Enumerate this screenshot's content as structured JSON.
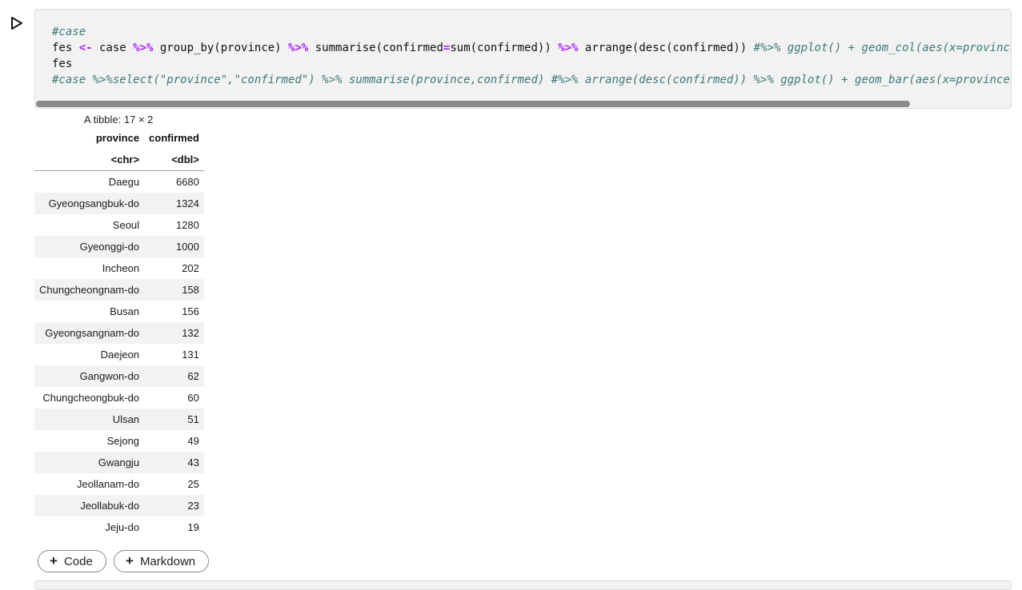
{
  "cell": {
    "code_lines": [
      [
        {
          "t": "#case",
          "c": "cm"
        }
      ],
      [
        {
          "t": "fes "
        },
        {
          "t": "<-",
          "c": "kw"
        },
        {
          "t": " case "
        },
        {
          "t": "%>%",
          "c": "kw"
        },
        {
          "t": " group_by(province) "
        },
        {
          "t": "%>%",
          "c": "kw"
        },
        {
          "t": " summarise(confirmed"
        },
        {
          "t": "=",
          "c": "kw"
        },
        {
          "t": "sum(confirmed)) "
        },
        {
          "t": "%>%",
          "c": "kw"
        },
        {
          "t": " arrange(desc(confirmed)) "
        },
        {
          "t": "#%>% ggplot() + geom_col(aes(x=province",
          "c": "cm"
        }
      ],
      [
        {
          "t": "fes"
        }
      ],
      [
        {
          "t": "#case %>%select(\"province\",\"confirmed\") %>% summarise(province,confirmed) #%>% arrange(desc(confirmed)) %>% ggplot() + geom_bar(aes(x=province,",
          "c": "cm"
        }
      ]
    ]
  },
  "output": {
    "caption": "A tibble: 17 × 2",
    "columns": [
      "province",
      "confirmed"
    ],
    "types": [
      "<chr>",
      "<dbl>"
    ],
    "rows": [
      [
        "Daegu",
        "6680"
      ],
      [
        "Gyeongsangbuk-do",
        "1324"
      ],
      [
        "Seoul",
        "1280"
      ],
      [
        "Gyeonggi-do",
        "1000"
      ],
      [
        "Incheon",
        "202"
      ],
      [
        "Chungcheongnam-do",
        "158"
      ],
      [
        "Busan",
        "156"
      ],
      [
        "Gyeongsangnam-do",
        "132"
      ],
      [
        "Daejeon",
        "131"
      ],
      [
        "Gangwon-do",
        "62"
      ],
      [
        "Chungcheongbuk-do",
        "60"
      ],
      [
        "Ulsan",
        "51"
      ],
      [
        "Sejong",
        "49"
      ],
      [
        "Gwangju",
        "43"
      ],
      [
        "Jeollanam-do",
        "25"
      ],
      [
        "Jeollabuk-do",
        "23"
      ],
      [
        "Jeju-do",
        "19"
      ]
    ]
  },
  "toolbar": {
    "add_code_label": "Code",
    "add_markdown_label": "Markdown"
  }
}
